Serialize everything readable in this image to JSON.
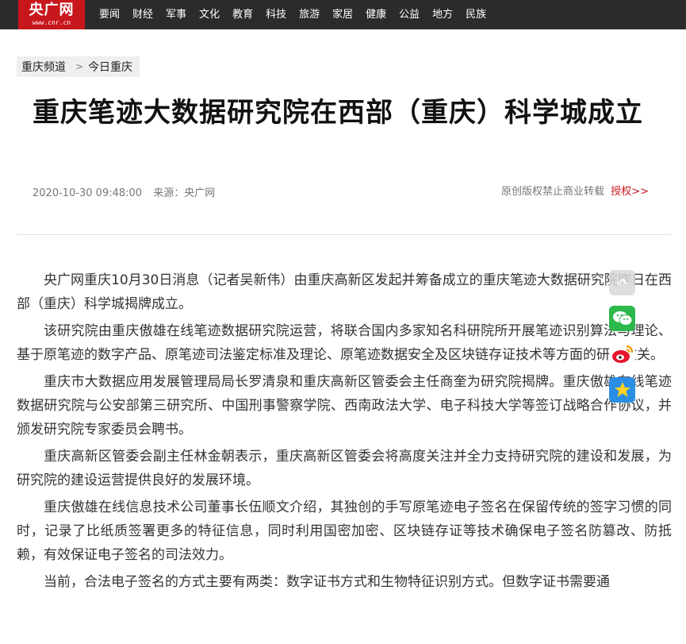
{
  "header": {
    "logo_text": "央广网",
    "logo_url": "www.cnr.cn",
    "nav": [
      "要闻",
      "财经",
      "军事",
      "文化",
      "教育",
      "科技",
      "旅游",
      "家居",
      "健康",
      "公益",
      "地方",
      "民族"
    ]
  },
  "breadcrumb": {
    "channel": "重庆频道",
    "separator": ">",
    "section": "今日重庆"
  },
  "article": {
    "title": "重庆笔迹大数据研究院在西部（重庆）科学城成立",
    "date": "2020-10-30 09:48:00",
    "source": "来源：央广网",
    "rights_text": "原创版权禁止商业转载",
    "rights_link": "授权>>",
    "paragraphs": [
      "央广网重庆10月30日消息（记者吴新伟）由重庆高新区发起并筹备成立的重庆笔迹大数据研究院昨日在西部（重庆）科学城揭牌成立。",
      "该研究院由重庆傲雄在线笔迹数据研究院运营，将联合国内多家知名科研院所开展笔迹识别算法与理论、基于原笔迹的数字产品、原笔迹司法鉴定标准及理论、原笔迹数据安全及区块链存证技术等方面的研究攻关。",
      "重庆市大数据应用发展管理局局长罗清泉和重庆高新区管委会主任商奎为研究院揭牌。重庆傲雄在线笔迹数据研究院与公安部第三研究所、中国刑事警察学院、西南政法大学、电子科技大学等签订战略合作协议，并颁发研究院专家委员会聘书。",
      "重庆高新区管委会副主任林金朝表示，重庆高新区管委会将高度关注并全力支持研究院的建设和发展，为研究院的建设运营提供良好的发展环境。",
      "重庆傲雄在线信息技术公司董事长伍顺文介绍，其独创的手写原笔迹电子签名在保留传统的签字习惯的同时，记录了比纸质签署更多的特征信息，同时利用国密加密、区块链存证等技术确保电子签名防篡改、防抵赖，有效保证电子签名的司法效力。",
      "当前，合法电子签名的方式主要有两类：数字证书方式和生物特征识别方式。但数字证书需要通"
    ]
  },
  "share_icons": [
    "back-to-top-icon",
    "wechat-icon",
    "weibo-icon",
    "qzone-icon"
  ]
}
